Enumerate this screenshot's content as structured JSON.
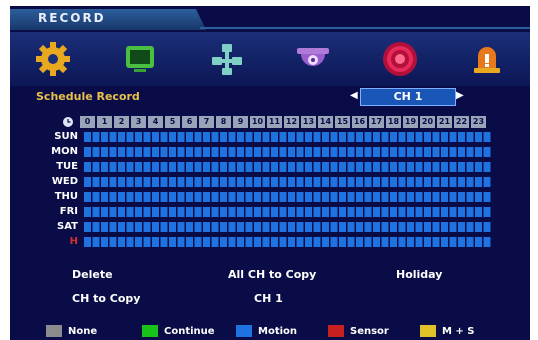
{
  "window": {
    "title": "RECORD"
  },
  "nav_icons": [
    {
      "name": "gear-icon"
    },
    {
      "name": "monitor-icon"
    },
    {
      "name": "network-icon"
    },
    {
      "name": "dome-camera-icon"
    },
    {
      "name": "record-icon"
    },
    {
      "name": "alarm-icon"
    }
  ],
  "schedule": {
    "label": "Schedule Record",
    "channel": "CH 1",
    "hours": [
      "0",
      "1",
      "2",
      "3",
      "4",
      "5",
      "6",
      "7",
      "8",
      "9",
      "10",
      "11",
      "12",
      "13",
      "14",
      "15",
      "16",
      "17",
      "18",
      "19",
      "20",
      "21",
      "22",
      "23"
    ],
    "days": [
      "SUN",
      "MON",
      "TUE",
      "WED",
      "THU",
      "FRI",
      "SAT",
      "H"
    ],
    "fill_mode": "Motion"
  },
  "actions": {
    "delete": "Delete",
    "all_ch_copy": "All CH to Copy",
    "holiday": "Holiday",
    "ch_copy": "CH to Copy",
    "ch_copy_value": "CH 1"
  },
  "legend": [
    {
      "label": "None",
      "color": "#8c8c8c"
    },
    {
      "label": "Continue",
      "color": "#19c219"
    },
    {
      "label": "Motion",
      "color": "#1f73e0"
    },
    {
      "label": "Sensor",
      "color": "#c81f1f"
    },
    {
      "label": "M + S",
      "color": "#e0c22a"
    }
  ]
}
